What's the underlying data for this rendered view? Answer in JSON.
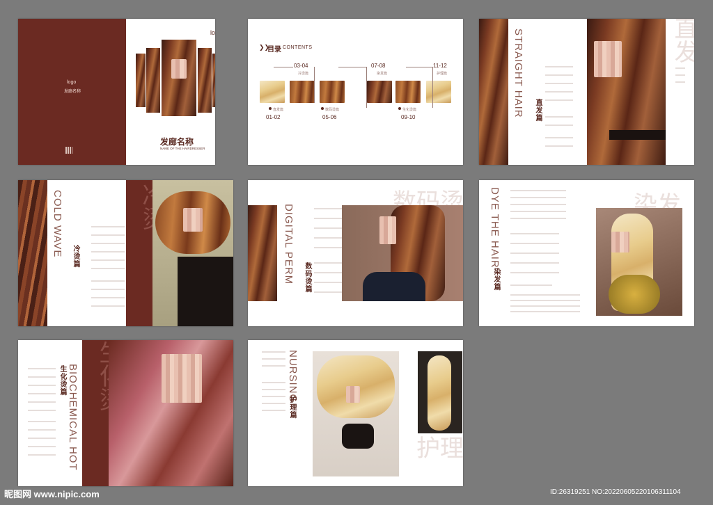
{
  "cover": {
    "logo_right": "logo",
    "logo_left": "logo",
    "brand_small": "发廊名称",
    "title_cn": "发廊名称",
    "title_en": "NAME OF THE HAIRDRESSER"
  },
  "contents": {
    "title_cn": "目录",
    "title_en": "CONTENTS",
    "items": [
      {
        "page": "01-02",
        "label": "直发篇"
      },
      {
        "page": "03-04",
        "label": "冷烫篇"
      },
      {
        "page": "05-06",
        "label": "数码烫篇"
      },
      {
        "page": "07-08",
        "label": "染发篇"
      },
      {
        "page": "09-10",
        "label": "生化烫篇"
      },
      {
        "page": "11-12",
        "label": "护理篇"
      }
    ]
  },
  "straight": {
    "title_en": "STRAIGHT HAIR",
    "title_cn": "直发篇",
    "watermark": "直发"
  },
  "coldwave": {
    "title_en": "COLD WAVE",
    "title_cn": "冷烫篇",
    "watermark": "冷烫"
  },
  "digital": {
    "title_en": "DIGITAL PERM",
    "title_cn": "数码烫篇",
    "watermark": "数码烫"
  },
  "dye": {
    "title_en": "DYE THE HAIR",
    "title_cn": "染发篇",
    "watermark": "染发"
  },
  "biochem": {
    "title_en": "BIOCHEMICAL HOT",
    "title_cn": "生化烫篇",
    "watermark": "生化烫"
  },
  "nursing": {
    "title_en": "NURSING",
    "title_cn": "护理篇",
    "watermark": "护理"
  },
  "footer": {
    "site": "昵图网 www.nipic.com",
    "id": "ID:26319251 NO:20220605220106311104"
  }
}
